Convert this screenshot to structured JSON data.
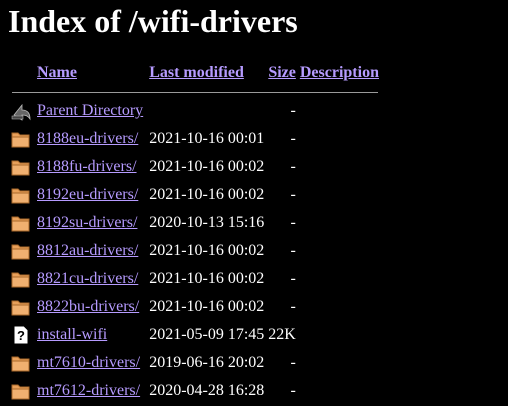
{
  "page": {
    "title": "Index of /wifi-drivers"
  },
  "table": {
    "headers": {
      "name": "Name",
      "last_modified": "Last modified",
      "size": "Size",
      "description": "Description"
    },
    "rows": [
      {
        "icon": "back-icon",
        "name": "Parent Directory",
        "modified": "",
        "size": "-",
        "desc": ""
      },
      {
        "icon": "folder-icon",
        "name": "8188eu-drivers/",
        "modified": "2021-10-16 00:01",
        "size": "-",
        "desc": ""
      },
      {
        "icon": "folder-icon",
        "name": "8188fu-drivers/",
        "modified": "2021-10-16 00:02",
        "size": "-",
        "desc": ""
      },
      {
        "icon": "folder-icon",
        "name": "8192eu-drivers/",
        "modified": "2021-10-16 00:02",
        "size": "-",
        "desc": ""
      },
      {
        "icon": "folder-icon",
        "name": "8192su-drivers/",
        "modified": "2020-10-13 15:16",
        "size": "-",
        "desc": ""
      },
      {
        "icon": "folder-icon",
        "name": "8812au-drivers/",
        "modified": "2021-10-16 00:02",
        "size": "-",
        "desc": ""
      },
      {
        "icon": "folder-icon",
        "name": "8821cu-drivers/",
        "modified": "2021-10-16 00:02",
        "size": "-",
        "desc": ""
      },
      {
        "icon": "folder-icon",
        "name": "8822bu-drivers/",
        "modified": "2021-10-16 00:02",
        "size": "-",
        "desc": ""
      },
      {
        "icon": "unknown-file-icon",
        "name": "install-wifi",
        "modified": "2021-05-09 17:45",
        "size": "22K",
        "desc": ""
      },
      {
        "icon": "folder-icon",
        "name": "mt7610-drivers/",
        "modified": "2019-06-16 20:02",
        "size": "-",
        "desc": ""
      },
      {
        "icon": "folder-icon",
        "name": "mt7612-drivers/",
        "modified": "2020-04-28 16:28",
        "size": "-",
        "desc": ""
      }
    ]
  },
  "colors": {
    "background": "#000000",
    "text": "#ffffff",
    "link": "#b69bff",
    "folder": "#e8a05a",
    "rule": "#9a9a9a"
  }
}
